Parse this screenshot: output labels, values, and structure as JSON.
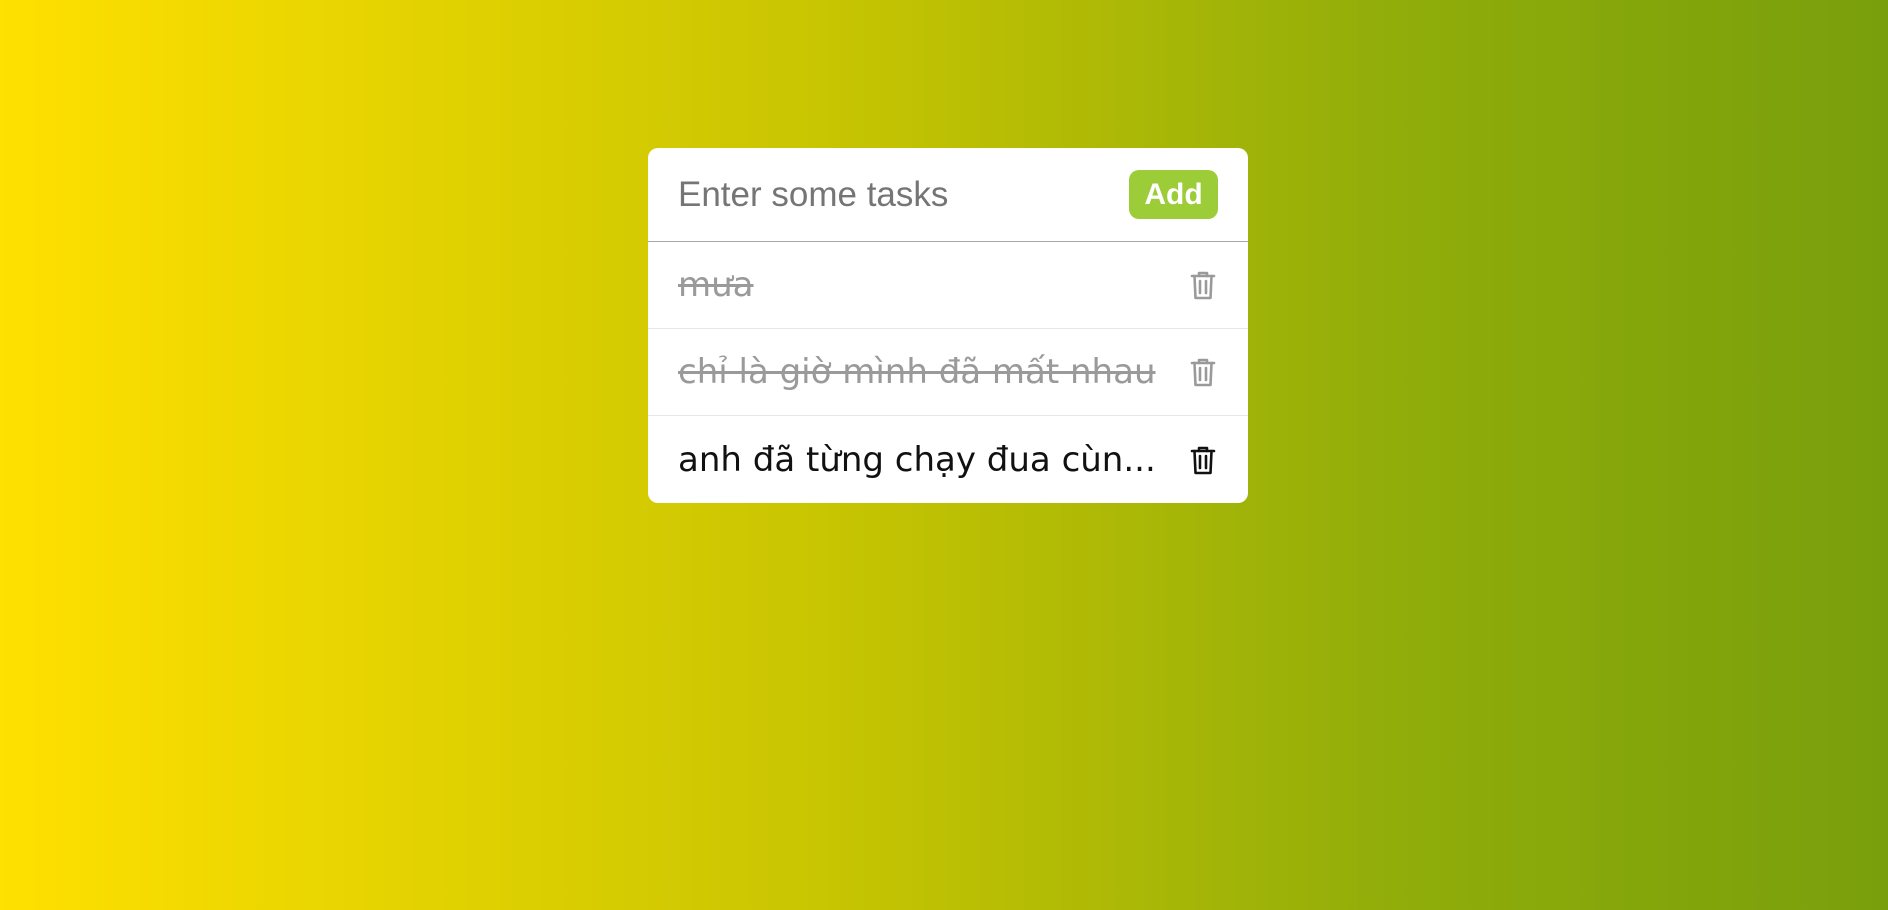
{
  "todo": {
    "input_placeholder": "Enter some tasks",
    "input_value": "",
    "add_label": "Add",
    "tasks": [
      {
        "text": "mưa",
        "done": true,
        "icon": "trash-icon"
      },
      {
        "text": "chỉ là giờ mình đã mất nhau",
        "done": true,
        "icon": "trash-icon"
      },
      {
        "text": "anh đã từng chạy đua cùn...",
        "done": false,
        "icon": "trash-icon"
      }
    ]
  },
  "colors": {
    "gradient_start": "#ffe000",
    "gradient_end": "#799f0c",
    "add_button": "#9ccc37",
    "done_text": "#9a9a9a"
  }
}
